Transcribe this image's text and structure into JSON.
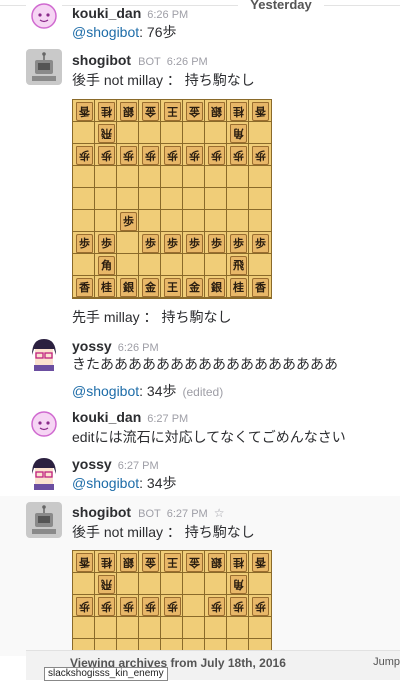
{
  "divider": {
    "label": "Yesterday"
  },
  "messages": [
    {
      "author": "kouki_dan",
      "time": "6:26 PM",
      "mention": "@shogibot",
      "text": ": 76歩"
    },
    {
      "author": "shogibot",
      "bot": "BOT",
      "time": "6:26 PM",
      "line1": "後手 not millay ： 持ち駒なし",
      "line2": "先手 millay ： 持ち駒なし"
    },
    {
      "author": "yossy",
      "time": "6:26 PM",
      "text": "きたあああああああああああああああああ",
      "mention": "@shogibot",
      "text2": ": 34歩",
      "edited": "(edited)"
    },
    {
      "author": "kouki_dan",
      "time": "6:27 PM",
      "text": "editには流石に対応してなくてごめんなさい"
    },
    {
      "author": "yossy",
      "time": "6:27 PM",
      "mention": "@shogibot",
      "text": ": 34歩"
    },
    {
      "author": "shogibot",
      "bot": "BOT",
      "time": "6:27 PM",
      "star": "☆",
      "line1": "後手 not millay ： 持ち駒なし"
    }
  ],
  "board1": [
    [
      "香g",
      "桂g",
      "銀g",
      "金g",
      "王g",
      "金g",
      "銀g",
      "桂g",
      "香g"
    ],
    [
      "",
      "飛g",
      "",
      "",
      "",
      "",
      "",
      "角g",
      ""
    ],
    [
      "歩g",
      "歩g",
      "歩g",
      "歩g",
      "歩g",
      "歩g",
      "歩g",
      "歩g",
      "歩g"
    ],
    [
      "",
      "",
      "",
      "",
      "",
      "",
      "",
      "",
      ""
    ],
    [
      "",
      "",
      "",
      "",
      "",
      "",
      "",
      "",
      ""
    ],
    [
      "",
      "",
      "歩",
      "",
      "",
      "",
      "",
      "",
      ""
    ],
    [
      "歩",
      "歩",
      "",
      "歩",
      "歩",
      "歩",
      "歩",
      "歩",
      "歩"
    ],
    [
      "",
      "角",
      "",
      "",
      "",
      "",
      "",
      "飛",
      ""
    ],
    [
      "香",
      "桂",
      "銀",
      "金",
      "王",
      "金",
      "銀",
      "桂",
      "香"
    ]
  ],
  "board2": [
    [
      "香g",
      "桂g",
      "銀g",
      "金g",
      "王g",
      "金g",
      "銀g",
      "桂g",
      "香g"
    ],
    [
      "",
      "飛g",
      "",
      "",
      "",
      "",
      "",
      "角g",
      ""
    ],
    [
      "歩g",
      "歩g",
      "歩g",
      "歩g",
      "歩g",
      "",
      "歩g",
      "歩g",
      "歩g"
    ],
    [
      "",
      "",
      "",
      "",
      "",
      "",
      "",
      "",
      ""
    ],
    [
      "",
      "",
      "",
      "",
      "",
      "",
      "",
      "",
      ""
    ]
  ],
  "footer": {
    "text": "Viewing archives from July 18th, 2016",
    "jump": "Jump"
  },
  "tooltip": "slackshogisss_kin_enemy"
}
